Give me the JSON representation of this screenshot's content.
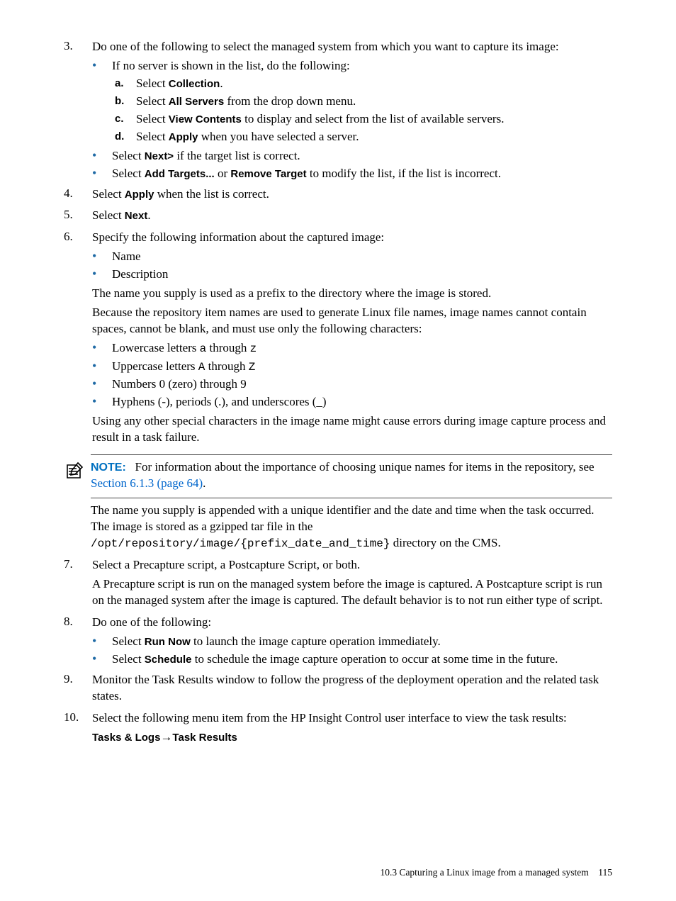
{
  "steps": {
    "s3": {
      "num": "3.",
      "intro": "Do one of the following to select the managed system from which you want to capture its image:",
      "b1_intro": "If no server is shown in the list, do the following:",
      "a_num": "a.",
      "a_pre": "Select ",
      "a_bold": "Collection",
      "a_post": ".",
      "b_num": "b.",
      "b_pre": "Select ",
      "b_bold": "All Servers",
      "b_post": " from the drop down menu.",
      "c_num": "c.",
      "c_pre": "Select ",
      "c_bold": "View Contents",
      "c_post": " to display and select from the list of available servers.",
      "d_num": "d.",
      "d_pre": "Select ",
      "d_bold": "Apply",
      "d_post": " when you have selected a server.",
      "b2_pre": "Select ",
      "b2_bold": "Next>",
      "b2_post": " if the target list is correct.",
      "b3_pre": "Select ",
      "b3_bold1": "Add Targets...",
      "b3_mid": " or ",
      "b3_bold2": "Remove Target",
      "b3_post": " to modify the list, if the list is incorrect."
    },
    "s4": {
      "num": "4.",
      "pre": "Select ",
      "bold": "Apply",
      "post": " when the list is correct."
    },
    "s5": {
      "num": "5.",
      "pre": "Select ",
      "bold": "Next",
      "post": "."
    },
    "s6": {
      "num": "6.",
      "intro": "Specify the following information about the captured image:",
      "b1": "Name",
      "b2": "Description",
      "p1": "The name you supply is used as a prefix to the directory where the image is stored.",
      "p2": "Because the repository item names are used to generate Linux file names, image names cannot contain spaces, cannot be blank, and must use only the following characters:",
      "c1_pre": "Lowercase letters ",
      "c1_m1": "a",
      "c1_mid": " through ",
      "c1_m2": "z",
      "c2_pre": "Uppercase letters ",
      "c2_m1": "A",
      "c2_mid": " through ",
      "c2_m2": "Z",
      "c3": "Numbers 0 (zero) through 9",
      "c4": "Hyphens (-), periods (.), and underscores (_)",
      "p3": "Using any other special characters in the image name might cause errors during image capture process and result in a task failure."
    },
    "note": {
      "label": "NOTE:",
      "pre": "For information about the importance of choosing unique names for items in the repository, see ",
      "link": "Section 6.1.3 (page 64)",
      "post": "."
    },
    "s6b": {
      "p1_a": "The name you supply is appended with a unique identifier and the date and time when the task occurred. The image is stored as a gzipped tar file in the ",
      "p1_m1": "/opt/repository/image/{prefix_date_and_time}",
      "p1_b": " directory on the CMS."
    },
    "s7": {
      "num": "7.",
      "p1": "Select a Precapture script, a Postcapture Script, or both.",
      "p2": "A Precapture script is run on the managed system before the image is captured. A Postcapture script is run on the managed system after the image is captured. The default behavior is to not run either type of script."
    },
    "s8": {
      "num": "8.",
      "intro": "Do one of the following:",
      "b1_pre": "Select ",
      "b1_bold": "Run Now",
      "b1_post": " to launch the image capture operation immediately.",
      "b2_pre": "Select ",
      "b2_bold": "Schedule",
      "b2_post": " to schedule the image capture operation to occur at some time in the future."
    },
    "s9": {
      "num": "9.",
      "text": "Monitor the Task Results window to follow the progress of the deployment operation and the related task states."
    },
    "s10": {
      "num": "10.",
      "intro": "Select the following menu item from the HP Insight Control user interface to view the task results:",
      "path_a": "Tasks & Logs",
      "path_arrow": "→",
      "path_b": "Task Results"
    }
  },
  "footer": {
    "section": "10.3 Capturing a Linux image from a managed system",
    "page": "115"
  }
}
